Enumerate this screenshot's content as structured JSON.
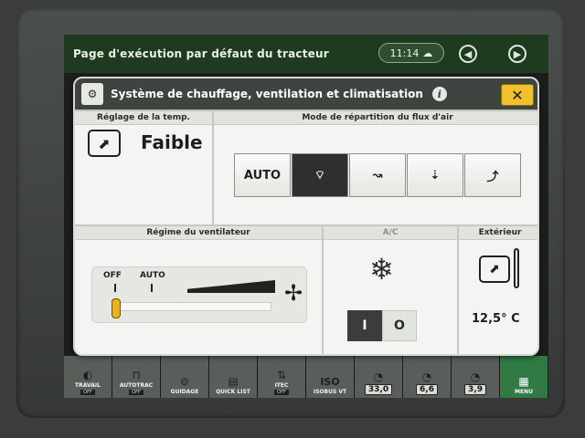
{
  "topbar": {
    "title": "Page d'exécution par défaut du tracteur",
    "time": "11:14",
    "cloud_icon": "cloud-sync-icon",
    "back_icon": "arrow-left-icon",
    "forward_icon": "arrow-right-icon"
  },
  "dialog": {
    "title": "Système de chauffage, ventilation et climatisation",
    "close_label": "✕",
    "temp": {
      "header": "Réglage de la temp.",
      "value": "Faible"
    },
    "airflow": {
      "header": "Mode de répartition du flux d'air",
      "buttons": [
        {
          "label": "AUTO",
          "icon": "auto-text",
          "selected": false
        },
        {
          "label": "",
          "icon": "windshield-defrost-icon",
          "selected": true
        },
        {
          "label": "",
          "icon": "floor-airflow-icon",
          "selected": false
        },
        {
          "label": "",
          "icon": "defrost-floor-icon",
          "selected": false
        },
        {
          "label": "",
          "icon": "face-airflow-icon",
          "selected": false
        }
      ],
      "selected_index": 1
    },
    "fan": {
      "header": "Régime du ventilateur",
      "off_label": "OFF",
      "auto_label": "AUTO",
      "level": 0
    },
    "ac": {
      "header": "A/C",
      "on_label": "I",
      "off_label": "O",
      "state": "I"
    },
    "exterior": {
      "header": "Extérieur",
      "temperature": "12,5° C"
    }
  },
  "bottombar": {
    "items": [
      {
        "label": "TRAVAIL",
        "sub": "OFF",
        "icon": "work-lights-icon"
      },
      {
        "label": "AUTOTRAC",
        "sub": "OFF",
        "icon": "autotrac-icon"
      },
      {
        "label": "GUIDAGE",
        "sub": "",
        "icon": "guidance-icon"
      },
      {
        "label": "QUICK LIST",
        "sub": "",
        "icon": "quick-list-icon"
      },
      {
        "label": "ITEC",
        "sub": "OFF",
        "icon": "itec-icon"
      },
      {
        "label": "ISOBUS VT",
        "sub": "",
        "icon": "isobus-icon"
      },
      {
        "label": "",
        "value": "33,0",
        "icon": "speed-gauge-icon"
      },
      {
        "label": "",
        "value": "6,6",
        "icon": "gauge-icon"
      },
      {
        "label": "",
        "value": "3,9",
        "icon": "gauge-icon"
      },
      {
        "label": "MENU",
        "sub": "",
        "icon": "menu-grid-icon"
      }
    ]
  }
}
